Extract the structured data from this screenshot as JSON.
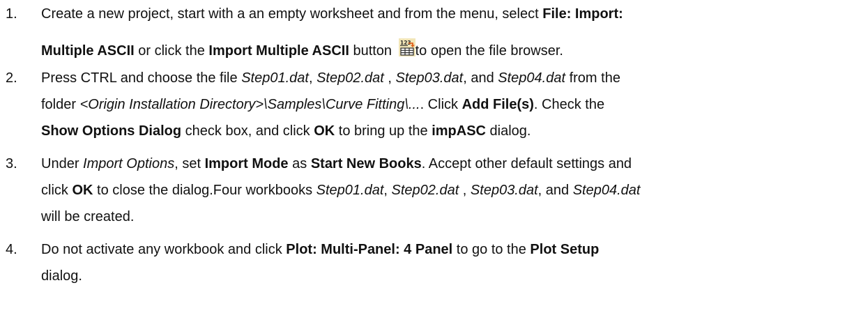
{
  "steps": [
    {
      "number": "1.",
      "line1": {
        "t1": "Create a new project, start with a an empty worksheet and from the menu, select ",
        "b1": "File: Import:"
      },
      "line2": {
        "b1": "Multiple ASCII",
        "t1": " or click the ",
        "b2": "Import Multiple ASCII",
        "t2": " button ",
        "icon": "import-multiple-ascii-icon",
        "icon_text": "123",
        "t3": "to open the file browser."
      }
    },
    {
      "number": "2.",
      "line1": {
        "t1": "Press CTRL and choose the file ",
        "i1": "Step01.dat",
        "t2": ", ",
        "i2": "Step02.dat",
        "t3": " , ",
        "i3": "Step03.dat",
        "t4": ", and ",
        "i4": "Step04.dat",
        "t5": " from the"
      },
      "line2": {
        "t1": "folder ",
        "i1": "<Origin Installation Directory>\\Samples\\Curve Fitting\\...",
        "t2": ". Click ",
        "b1": "Add File(s)",
        "t3": ". Check the"
      },
      "line3": {
        "b1": "Show Options Dialog",
        "t1": " check box, and click ",
        "b2": "OK",
        "t2": " to bring up the ",
        "b3": "impASC",
        "t3": " dialog."
      }
    },
    {
      "number": "3.",
      "line1": {
        "t1": "Under ",
        "i1": "Import Options",
        "t2": ", set ",
        "b1": "Import Mode",
        "t3": " as ",
        "b2": "Start New Books",
        "t4": ". Accept other default settings and"
      },
      "line2": {
        "t1": "click ",
        "b1": "OK",
        "t2": " to close the dialog.Four workbooks ",
        "i1": "Step01.dat",
        "t3": ", ",
        "i2": "Step02.dat",
        "t4": " , ",
        "i3": "Step03.dat",
        "t5": ", and ",
        "i4": "Step04.dat"
      },
      "line3": {
        "t1": "will be created."
      }
    },
    {
      "number": "4.",
      "line1": {
        "t1": "Do not activate any workbook and click ",
        "b1": "Plot: Multi-Panel: 4 Panel",
        "t2": " to go to the ",
        "b2": "Plot Setup"
      },
      "line2": {
        "t1": "dialog."
      }
    }
  ],
  "colors": {
    "text": "#111111",
    "icon_arrow": "#e0601a",
    "icon_grid": "#2a2a2a",
    "icon_bg": "#f2e6b8"
  }
}
